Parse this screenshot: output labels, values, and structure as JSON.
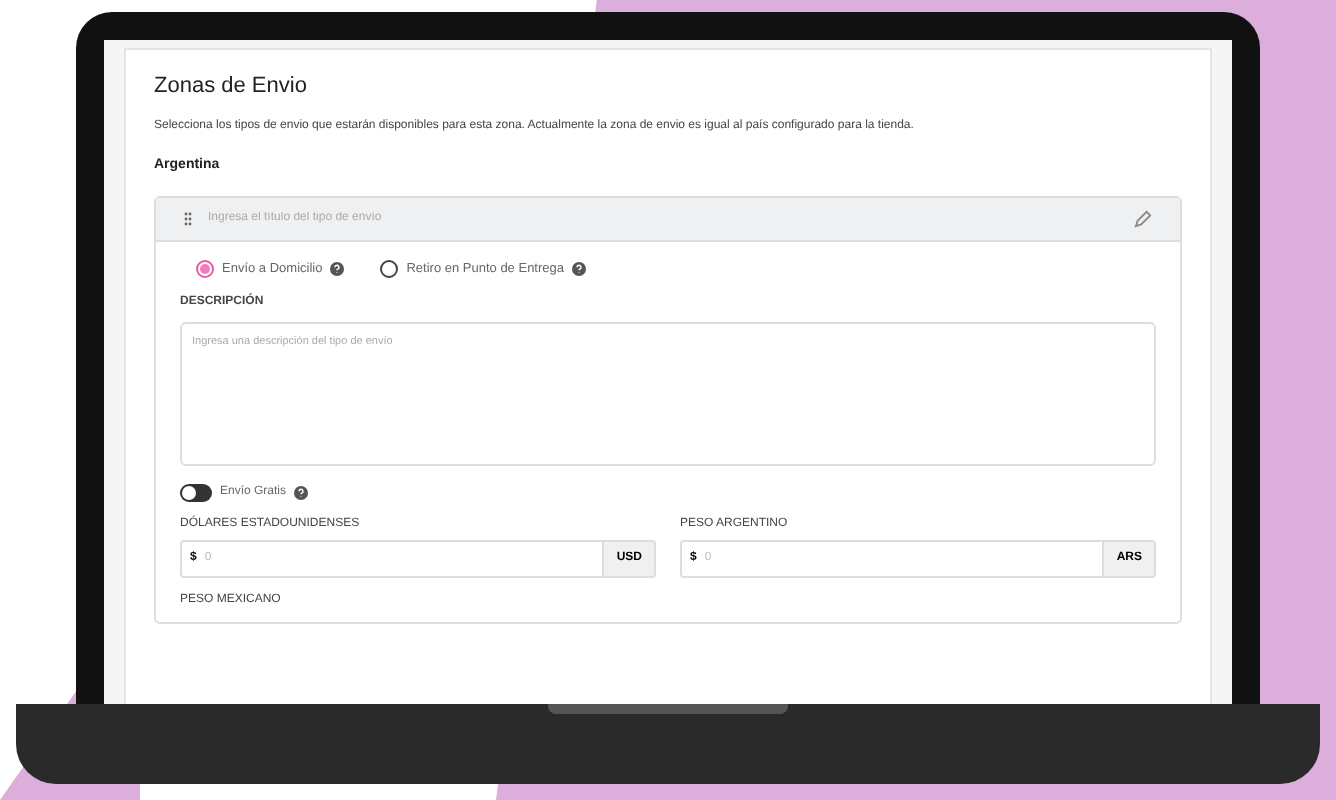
{
  "section": {
    "title": "Zonas de Envio",
    "description": "Selecciona los tipos de envio que estarán disponibles para esta zona. Actualmente la zona de envio es igual al país configurado para la tienda.",
    "country": "Argentina"
  },
  "shipping_type": {
    "title_placeholder": "Ingresa el título del tipo de envío",
    "options": [
      {
        "label": "Envío a Domicilio",
        "selected": true
      },
      {
        "label": "Retiro en Punto de Entrega",
        "selected": false
      }
    ],
    "description_label": "DESCRIPCIÓN",
    "description_placeholder": "Ingresa una descripción del tipo de envío",
    "free_shipping": {
      "label": "Envío Gratis",
      "on": false
    },
    "currencies": [
      {
        "label": "DÓLARES ESTADOUNIDENSES",
        "symbol": "$",
        "placeholder": "0",
        "code": "USD"
      },
      {
        "label": "PESO ARGENTINO",
        "symbol": "$",
        "placeholder": "0",
        "code": "ARS"
      }
    ],
    "next_currency_label": "PESO MEXICANO"
  }
}
